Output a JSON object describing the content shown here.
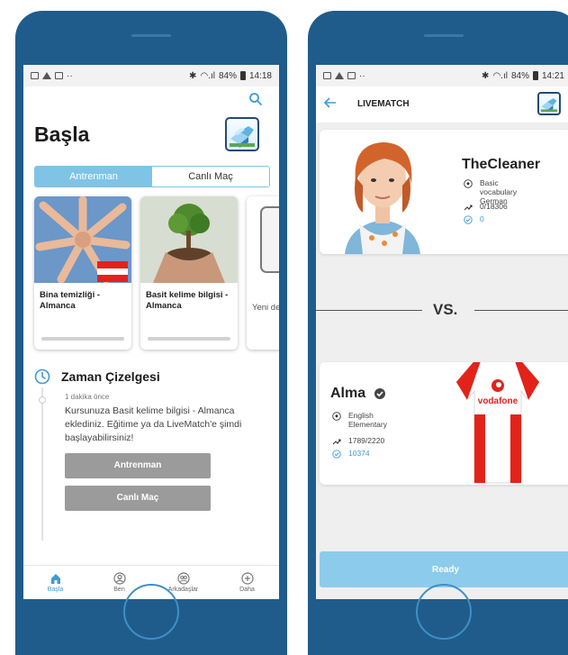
{
  "left": {
    "status": {
      "right_text": "84%",
      "time": "14:18"
    },
    "title": "Başla",
    "tabs": [
      {
        "label": "Antrenman",
        "active": true
      },
      {
        "label": "Canlı Maç",
        "active": false
      }
    ],
    "cards": [
      {
        "label": "Bina temizliği - Almanca"
      },
      {
        "label": "Basit kelime bilgisi - Almanca"
      },
      {
        "label": "Yeni ders s"
      }
    ],
    "timeline": {
      "title": "Zaman Çizelgesi",
      "time": "1 dakika önce",
      "message": "Kursunuza Basit kelime bilgisi - Almanca eklediniz. Eğitime ya da LiveMatch'e şimdi başlayabilirsiniz!",
      "buttons": [
        "Antrenman",
        "Canlı Maç"
      ]
    },
    "nav": [
      {
        "label": "Başla",
        "active": true,
        "icon": "home-icon"
      },
      {
        "label": "Ben",
        "active": false,
        "icon": "profile-icon"
      },
      {
        "label": "Arkadaşlar",
        "active": false,
        "icon": "friends-icon"
      },
      {
        "label": "Daha",
        "active": false,
        "icon": "plus-circle-icon"
      }
    ]
  },
  "right": {
    "status": {
      "right_text": "84%",
      "time": "14:21"
    },
    "title": "LIVEMATCH",
    "opponent": {
      "name": "TheCleaner",
      "course": "Basic vocabulary German",
      "progress": "0/18306",
      "score": "0"
    },
    "vs": "VS.",
    "me": {
      "name": "Alma",
      "course": "English Elementary",
      "progress": "1789/2220",
      "score": "10374",
      "jersey_brand": "vodafone"
    },
    "ready": "Ready"
  },
  "colors": {
    "phone": "#1f5c8c",
    "accent": "#7fc3e6",
    "link_blue": "#3f9ad4",
    "gray_button": "#9b9b9b",
    "jersey_red": "#e2231a"
  }
}
